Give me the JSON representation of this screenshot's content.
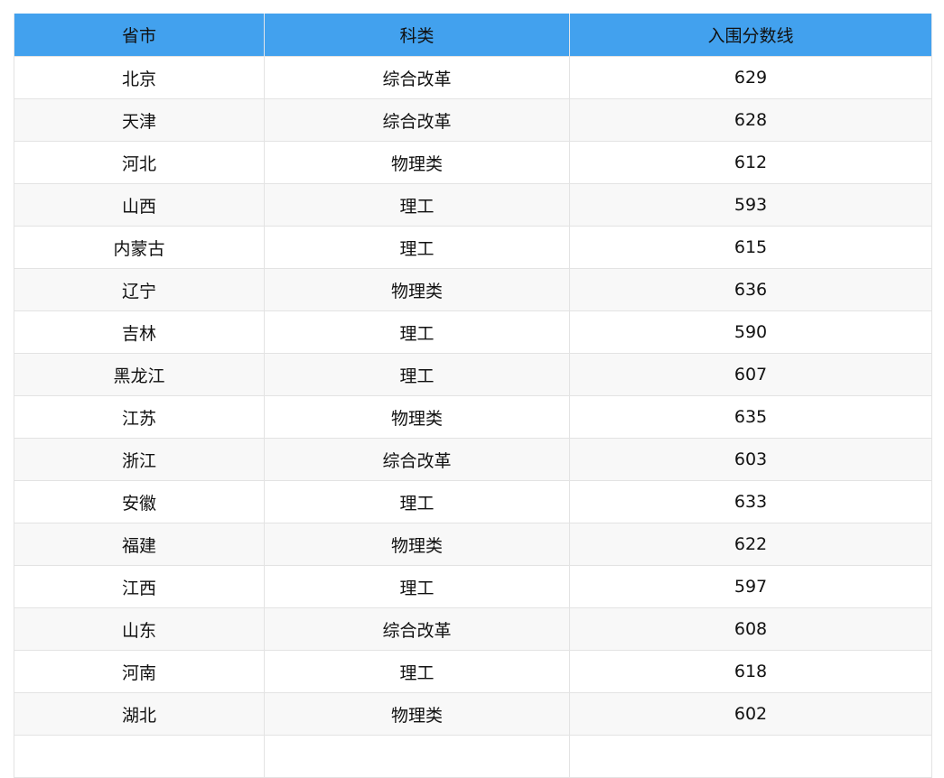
{
  "table": {
    "headers": [
      "省市",
      "科类",
      "入围分数线"
    ],
    "rows": [
      [
        "北京",
        "综合改革",
        "629"
      ],
      [
        "天津",
        "综合改革",
        "628"
      ],
      [
        "河北",
        "物理类",
        "612"
      ],
      [
        "山西",
        "理工",
        "593"
      ],
      [
        "内蒙古",
        "理工",
        "615"
      ],
      [
        "辽宁",
        "物理类",
        "636"
      ],
      [
        "吉林",
        "理工",
        "590"
      ],
      [
        "黑龙江",
        "理工",
        "607"
      ],
      [
        "江苏",
        "物理类",
        "635"
      ],
      [
        "浙江",
        "综合改革",
        "603"
      ],
      [
        "安徽",
        "理工",
        "633"
      ],
      [
        "福建",
        "物理类",
        "622"
      ],
      [
        "江西",
        "理工",
        "597"
      ],
      [
        "山东",
        "综合改革",
        "608"
      ],
      [
        "河南",
        "理工",
        "618"
      ],
      [
        "湖北",
        "物理类",
        "602"
      ]
    ]
  },
  "colors": {
    "header_bg": "#42a1ee",
    "stripe_bg": "#f8f8f8",
    "border": "#e3e3e3",
    "text": "#111111"
  }
}
